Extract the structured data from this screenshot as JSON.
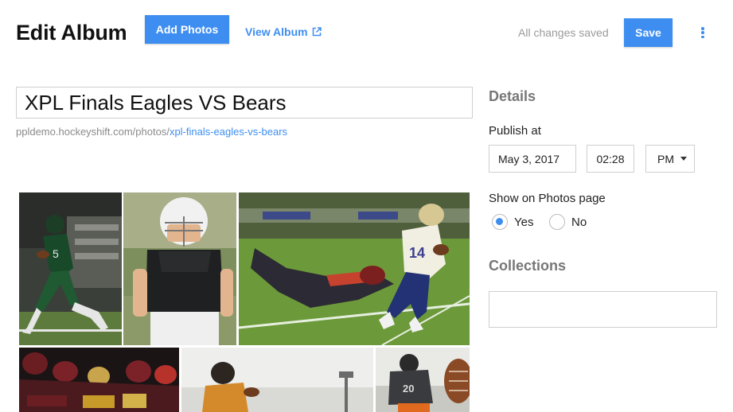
{
  "header": {
    "title": "Edit Album",
    "add_photos_label": "Add Photos",
    "view_album_label": "View Album",
    "status_text": "All changes saved",
    "save_label": "Save"
  },
  "album": {
    "title_value": "XPL Finals Eagles VS Bears",
    "url_base": "ppldemo.hockeyshift.com/photos/",
    "url_slug": "xpl-finals-eagles-vs-bears"
  },
  "details": {
    "heading": "Details",
    "publish_label": "Publish at",
    "date_value": "May 3, 2017",
    "time_value": "02:28",
    "ampm_value": "PM",
    "show_label": "Show on Photos page",
    "yes_label": "Yes",
    "no_label": "No",
    "selected": "Yes",
    "collections_heading": "Collections",
    "collections_value": ""
  },
  "photos": [
    {
      "name": "photo-football-runner-green",
      "subject": "player in green uniform running with ball"
    },
    {
      "name": "photo-youth-player-helmet",
      "subject": "young player in white helmet"
    },
    {
      "name": "photo-diving-tackle",
      "subject": "player diving to tackle runner"
    },
    {
      "name": "photo-line-of-scrimmage",
      "subject": "linemen at scrimmage"
    },
    {
      "name": "photo-quarterback-throwing",
      "subject": "player preparing to throw"
    },
    {
      "name": "photo-player-kneeling",
      "subject": "player kneeling holding ball"
    }
  ],
  "colors": {
    "accent": "#3d8ef0"
  }
}
